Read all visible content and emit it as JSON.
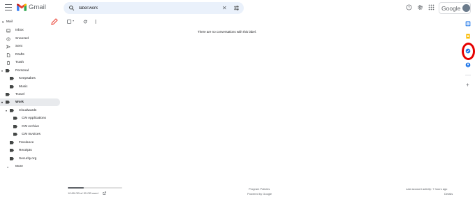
{
  "app": {
    "name": "Gmail"
  },
  "search": {
    "value": "label:work"
  },
  "header": {
    "google_label": "Google"
  },
  "sidebar": {
    "mail_label": "Mail",
    "items": [
      {
        "label": "Inbox"
      },
      {
        "label": "Snoozed"
      },
      {
        "label": "Sent"
      },
      {
        "label": "Drafts"
      },
      {
        "label": "Trash"
      },
      {
        "label": "Personal"
      },
      {
        "label": "Keepsakes"
      },
      {
        "label": "Music"
      },
      {
        "label": "Travel"
      },
      {
        "label": "Work"
      },
      {
        "label": "Cloudwards"
      },
      {
        "label": "CW Applications"
      },
      {
        "label": "CW Archive"
      },
      {
        "label": "CW Invoices"
      },
      {
        "label": "Freelance"
      },
      {
        "label": "Receipts"
      },
      {
        "label": "Security.org"
      },
      {
        "label": "More"
      }
    ]
  },
  "main": {
    "empty_message": "There are no conversations with this label."
  },
  "footer": {
    "storage": "10.65 GB of 30 GB used",
    "storage_fraction": 0.3,
    "policies": "Program Policies",
    "powered": "Powered by Google",
    "activity": "Last account activity: 7 hours ago",
    "details": "Details"
  },
  "colors": {
    "gmail_red": "#ea4335",
    "highlight": "#e50000",
    "active_bg": "#e8eaed"
  }
}
